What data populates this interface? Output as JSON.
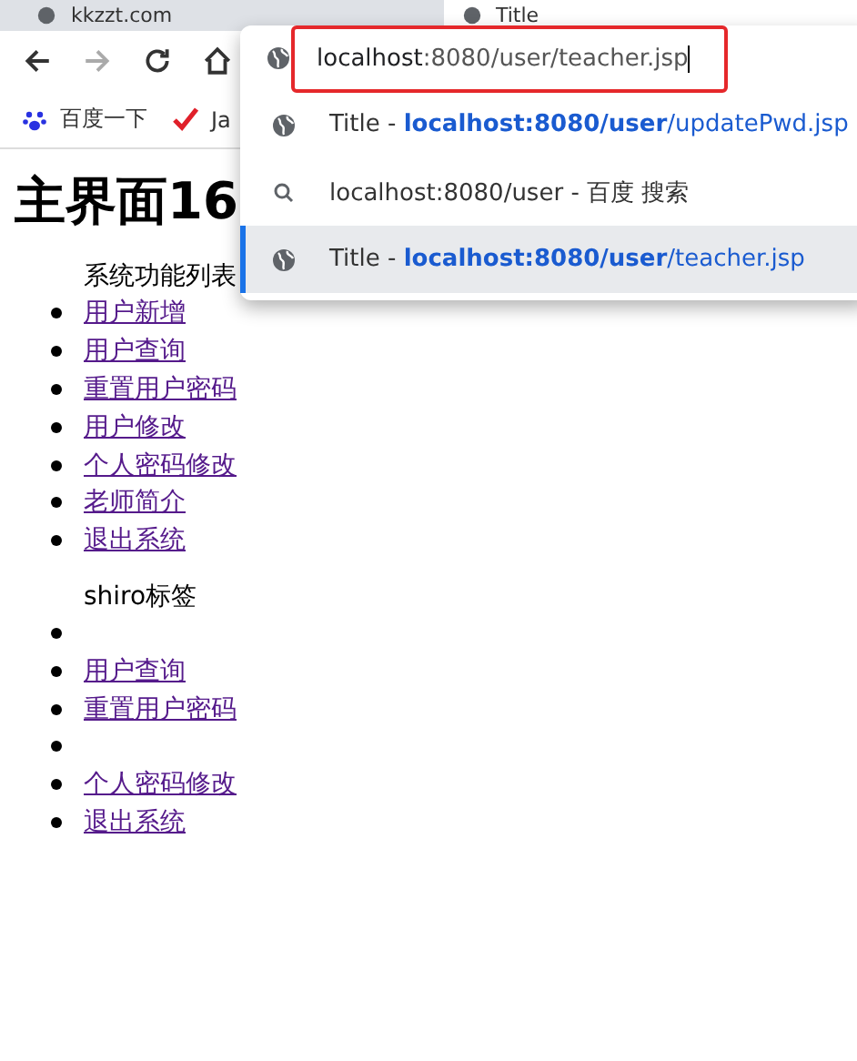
{
  "tabs": [
    {
      "label": "kkzzt.com",
      "selected": false
    },
    {
      "label": "Title",
      "selected": true
    }
  ],
  "omnibox": {
    "value_host": "localhost",
    "value_rest": ":8080/user/teacher.jsp"
  },
  "suggestions": [
    {
      "kind": "page",
      "title": "Title -",
      "match": "localhost:8080/user",
      "rest": "/updatePwd.jsp",
      "selected": false
    },
    {
      "kind": "search",
      "match": "localhost:8080/user",
      "rest": " - 百度 搜索",
      "selected": false
    },
    {
      "kind": "page",
      "title": "Title -",
      "match": "localhost:8080/user",
      "rest": "/teacher.jsp",
      "selected": true
    }
  ],
  "bookmarks": [
    {
      "kind": "paw",
      "label": "百度一下"
    },
    {
      "kind": "check",
      "label": "Ja"
    }
  ],
  "heading": "主界面16",
  "sections": [
    {
      "title": "系统功能列表",
      "items": [
        {
          "kind": "link",
          "label": "用户新增"
        },
        {
          "kind": "link",
          "label": "用户查询"
        },
        {
          "kind": "link",
          "label": "重置用户密码"
        },
        {
          "kind": "link",
          "label": "用户修改"
        },
        {
          "kind": "link",
          "label": "个人密码修改"
        },
        {
          "kind": "link",
          "label": "老师简介"
        },
        {
          "kind": "link",
          "label": "退出系统"
        }
      ]
    },
    {
      "title": "shiro标签",
      "items": [
        {
          "kind": "empty"
        },
        {
          "kind": "link",
          "label": "用户查询"
        },
        {
          "kind": "link",
          "label": "重置用户密码"
        },
        {
          "kind": "empty"
        },
        {
          "kind": "link",
          "label": "个人密码修改"
        },
        {
          "kind": "link",
          "label": "退出系统"
        }
      ]
    }
  ]
}
